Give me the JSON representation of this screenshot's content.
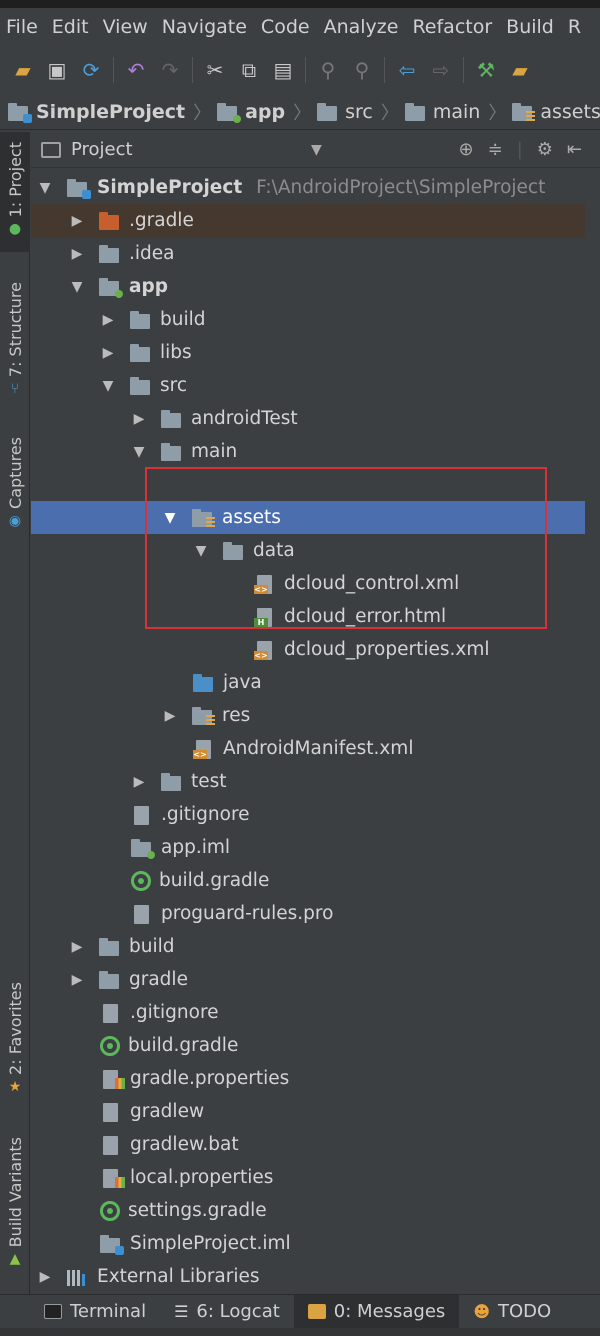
{
  "menu": [
    "File",
    "Edit",
    "View",
    "Navigate",
    "Code",
    "Analyze",
    "Refactor",
    "Build",
    "R"
  ],
  "breadcrumb": [
    "SimpleProject",
    "app",
    "src",
    "main",
    "assets"
  ],
  "left_tabs": [
    "1: Project",
    "7: Structure",
    "Captures",
    "2: Favorites",
    "Build Variants"
  ],
  "panel": {
    "title": "Project"
  },
  "tree": [
    {
      "label": "SimpleProject",
      "path": "F:\\AndroidProject\\SimpleProject"
    },
    {
      "label": ".gradle"
    },
    {
      "label": ".idea"
    },
    {
      "label": "app"
    },
    {
      "label": "build"
    },
    {
      "label": "libs"
    },
    {
      "label": "src"
    },
    {
      "label": "androidTest"
    },
    {
      "label": "main"
    },
    {
      "label": "assets"
    },
    {
      "label": "data"
    },
    {
      "label": "dcloud_control.xml"
    },
    {
      "label": "dcloud_error.html"
    },
    {
      "label": "dcloud_properties.xml"
    },
    {
      "label": "java"
    },
    {
      "label": "res"
    },
    {
      "label": "AndroidManifest.xml"
    },
    {
      "label": "test"
    },
    {
      "label": ".gitignore"
    },
    {
      "label": "app.iml"
    },
    {
      "label": "build.gradle"
    },
    {
      "label": "proguard-rules.pro"
    },
    {
      "label": "build"
    },
    {
      "label": "gradle"
    },
    {
      "label": ".gitignore"
    },
    {
      "label": "build.gradle"
    },
    {
      "label": "gradle.properties"
    },
    {
      "label": "gradlew"
    },
    {
      "label": "gradlew.bat"
    },
    {
      "label": "local.properties"
    },
    {
      "label": "settings.gradle"
    },
    {
      "label": "SimpleProject.iml"
    },
    {
      "label": "External Libraries"
    }
  ],
  "bottom_tabs": [
    "Terminal",
    "6: Logcat",
    "0: Messages",
    "TODO"
  ]
}
